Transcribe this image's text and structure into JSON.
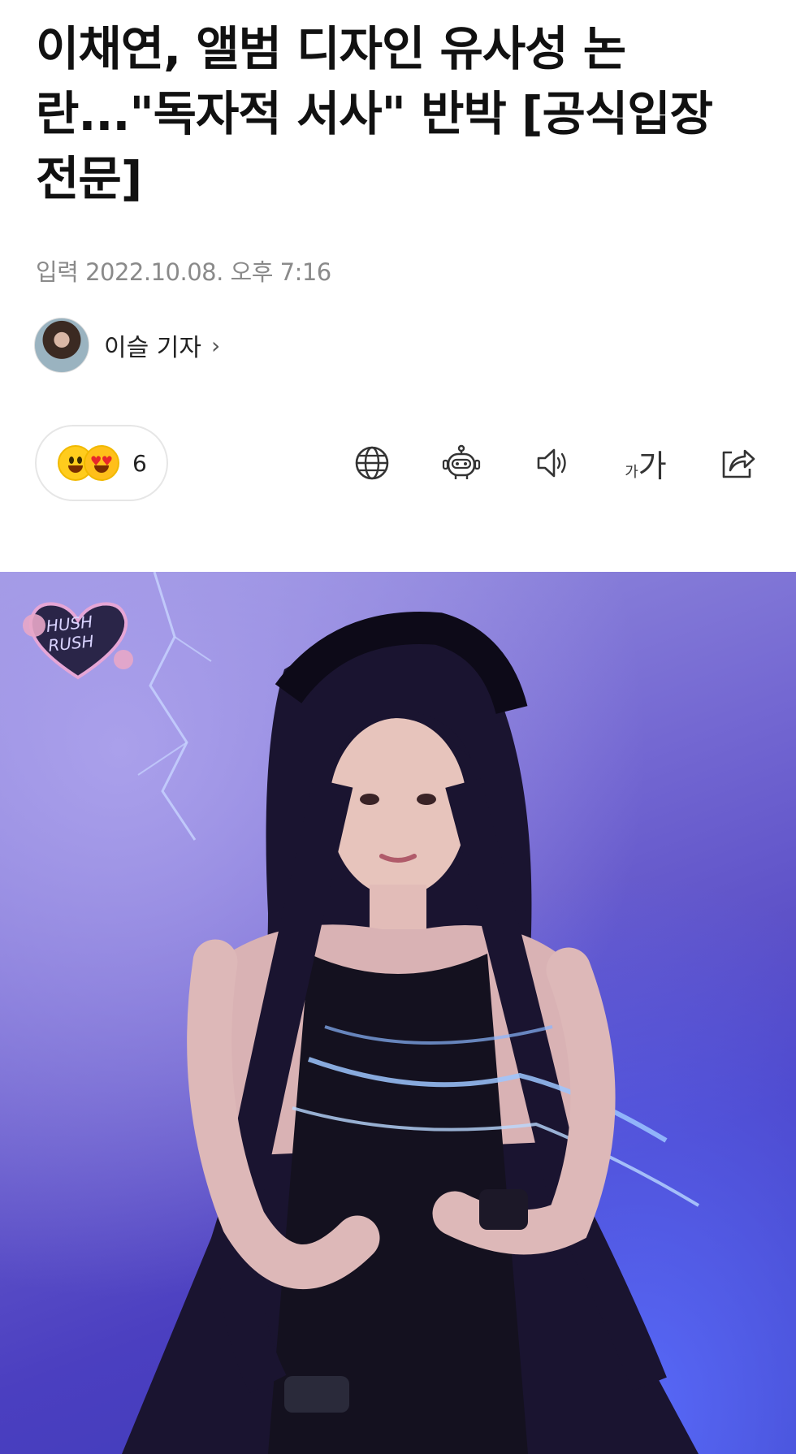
{
  "article": {
    "title": "이채연, 앨범 디자인 유사성 논란...\"독자적 서사\" 반박 [공식입장 전문]",
    "published": "입력 2022.10.08. 오후 7:16",
    "author": {
      "name": "이슬 기자",
      "chevron": "›"
    }
  },
  "reactions": {
    "count": "6"
  },
  "toolbar": {
    "icons": [
      "globe-icon",
      "robot-icon",
      "speaker-icon",
      "font-size-icon",
      "share-icon"
    ],
    "font_small": "가",
    "font_large": "가"
  },
  "hero_image": {
    "logo_text_line1": "HUSH",
    "logo_text_line2": "RUSH"
  },
  "colors": {
    "title": "#111111",
    "meta": "#8a8a8a",
    "pill_border": "#e6e6e6",
    "hero_bg": "#5a4fc8"
  }
}
